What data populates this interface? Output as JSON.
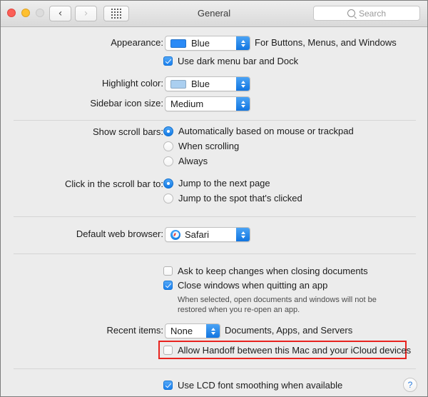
{
  "window": {
    "title": "General",
    "traffic_lights": [
      "close-button",
      "minimize-button",
      "zoom-button"
    ],
    "back_icon": "‹",
    "forward_icon": "›",
    "grid_icon": "show-all-grid-icon"
  },
  "search": {
    "placeholder": "Search",
    "icon": "search-icon"
  },
  "appearance": {
    "label": "Appearance:",
    "value": "Blue",
    "swatch_color": "#2a8af6",
    "trailing_text": "For Buttons, Menus, and Windows",
    "dark_menu_label": "Use dark menu bar and Dock",
    "dark_menu_checked": true
  },
  "highlight": {
    "label": "Highlight color:",
    "value": "Blue",
    "swatch_color": "#aacff0"
  },
  "sidebar_icon_size": {
    "label": "Sidebar icon size:",
    "value": "Medium"
  },
  "scroll_bars": {
    "label": "Show scroll bars:",
    "options": [
      {
        "label": "Automatically based on mouse or trackpad",
        "selected": true
      },
      {
        "label": "When scrolling",
        "selected": false
      },
      {
        "label": "Always",
        "selected": false
      }
    ]
  },
  "scroll_click": {
    "label": "Click in the scroll bar to:",
    "options": [
      {
        "label": "Jump to the next page",
        "selected": true
      },
      {
        "label": "Jump to the spot that's clicked",
        "selected": false
      }
    ]
  },
  "default_browser": {
    "label": "Default web browser:",
    "value": "Safari",
    "icon": "safari-icon"
  },
  "documents": {
    "ask_keep_changes": {
      "label": "Ask to keep changes when closing documents",
      "checked": false
    },
    "close_windows": {
      "label": "Close windows when quitting an app",
      "checked": true
    },
    "close_windows_help_line1": "When selected, open documents and windows will not be",
    "close_windows_help_line2": "restored when you re-open an app."
  },
  "recent_items": {
    "label": "Recent items:",
    "value": "None",
    "trailing_text": "Documents, Apps, and Servers"
  },
  "handoff": {
    "label": "Allow Handoff between this Mac and your iCloud devices",
    "checked": false,
    "highlight_color": "#e8231f"
  },
  "font_smoothing": {
    "label": "Use LCD font smoothing when available",
    "checked": true
  },
  "help_button": {
    "label": "?"
  }
}
